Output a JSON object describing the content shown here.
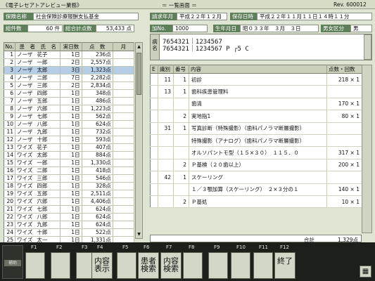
{
  "app": {
    "title": "《電子レセアトアレビュー業務》",
    "screen": "＝ 一覧画面 ＝",
    "rev": "Rev. 600012"
  },
  "header": {
    "insurer_label": "保険名称",
    "insurer_value": "社会保険診療報酬支払基金",
    "total_label": "総件数",
    "total_value": "60 件",
    "points_label": "総合計点数",
    "points_value": "53,433 点",
    "claim_year_label": "請求年月",
    "claim_year_value": "平成２２年１２月",
    "saved_label": "保存日時",
    "saved_value": "平成２２年１１月１１日１４時１１分",
    "add_label": "加No.",
    "add_value": "1000",
    "birth_label": "生年月日",
    "birth_value": "昭０３３年　３月　３日",
    "sex_label": "男女区分",
    "sex_value": "男",
    "disease_label": "病名",
    "disease_line1": "7654321｜1234567",
    "disease_line2": "7654321｜1234567 P ┌5 C"
  },
  "patients": {
    "columns": [
      "No.",
      "患　者　氏　名",
      "実日数",
      "点　数",
      "月"
    ],
    "rows": [
      [
        "1",
        "ノーザ",
        "花子",
        "1日",
        "236点",
        ""
      ],
      [
        "2",
        "ノーザ",
        "一郎",
        "2日",
        "2,557点",
        ""
      ],
      [
        "3",
        "ノーザ",
        "太郎",
        "3日",
        "1,323点",
        ""
      ],
      [
        "4",
        "ノーザ",
        "二郎",
        "7日",
        "2,282点",
        ""
      ],
      [
        "5",
        "ノーザ",
        "三郎",
        "2日",
        "2,834点",
        ""
      ],
      [
        "6",
        "ノーザ",
        "四郎",
        "1日",
        "348点",
        ""
      ],
      [
        "7",
        "ノーザ",
        "五郎",
        "1日",
        "486点",
        ""
      ],
      [
        "8",
        "ノーザ",
        "六郎",
        "1日",
        "1,223点",
        ""
      ],
      [
        "9",
        "ノーザ",
        "七郎",
        "1日",
        "562点",
        ""
      ],
      [
        "10",
        "ノーザ",
        "八郎",
        "1日",
        "624点",
        ""
      ],
      [
        "11",
        "ノーザ",
        "九郎",
        "1日",
        "732点",
        ""
      ],
      [
        "12",
        "ノーザ",
        "十郎",
        "1日",
        "593点",
        ""
      ],
      [
        "13",
        "ワイズ",
        "花子",
        "1日",
        "407点",
        ""
      ],
      [
        "14",
        "ワイズ",
        "太郎",
        "1日",
        "884点",
        ""
      ],
      [
        "15",
        "ワイズ",
        "一郎",
        "1日",
        "1,330点",
        ""
      ],
      [
        "16",
        "ワイズ",
        "二郎",
        "1日",
        "418点",
        ""
      ],
      [
        "17",
        "ワイズ",
        "三郎",
        "1日",
        "546点",
        ""
      ],
      [
        "18",
        "ワイズ",
        "四郎",
        "1日",
        "328点",
        ""
      ],
      [
        "19",
        "ワイズ",
        "五郎",
        "1日",
        "2,511点",
        ""
      ],
      [
        "20",
        "ワイズ",
        "六郎",
        "1日",
        "4,406点",
        ""
      ],
      [
        "21",
        "ワイズ",
        "七郎",
        "1日",
        "624点",
        ""
      ],
      [
        "22",
        "ワイズ",
        "八郎",
        "1日",
        "624点",
        ""
      ],
      [
        "23",
        "ワイズ",
        "九郎",
        "1日",
        "624点",
        ""
      ],
      [
        "24",
        "ワイズ",
        "十郎",
        "1日",
        "522点",
        ""
      ],
      [
        "25",
        "ワイズ",
        "太一",
        "1日",
        "1,331点",
        ""
      ]
    ]
  },
  "details": {
    "columns": [
      "E",
      "識別",
      "番号",
      "内容",
      "点数・回数"
    ],
    "rows": [
      [
        "",
        "11",
        "1",
        "初診",
        "218 × 1"
      ],
      [
        "",
        "13",
        "1",
        "歯科疾患管理料",
        ""
      ],
      [
        "",
        "",
        "",
        "歯清",
        "170 × 1"
      ],
      [
        "",
        "",
        "2",
        "実地指1",
        "80 × 1"
      ],
      [
        "",
        "31",
        "1",
        "写真診断（特殊撮影）（歯科パノラマ断層撮影）",
        ""
      ],
      [
        "",
        "",
        "",
        "特殊撮影（アナログ）（歯科パノラマ断層撮影）",
        ""
      ],
      [
        "",
        "",
        "",
        "オルソパントモ型（１５×３０）　１１５．０",
        "317 × 1"
      ],
      [
        "",
        "",
        "2",
        "Ｐ基検（２０歯以上）",
        "200 × 1"
      ],
      [
        "",
        "42",
        "1",
        "スケーリング",
        ""
      ],
      [
        "",
        "",
        "",
        "１／３顎加算（スケーリング）　２×３分の１",
        "140 × 1"
      ],
      [
        "",
        "",
        "2",
        "Ｐ基処",
        "10 × 1"
      ]
    ],
    "total_label": "合計",
    "total_value": "1,329点"
  },
  "fkeys": {
    "keys": [
      {
        "label": "F1",
        "text": ""
      },
      {
        "label": "F2",
        "text": ""
      },
      {
        "label": "F3",
        "text": ""
      },
      {
        "label": "F4",
        "text": "内容\n表示"
      },
      {
        "label": "F5",
        "text": ""
      },
      {
        "label": "F6",
        "text": "患者\n検索"
      },
      {
        "label": "F7",
        "text": "内容\n検索"
      },
      {
        "label": "F8",
        "text": ""
      },
      {
        "label": "F9",
        "text": ""
      },
      {
        "label": "F10",
        "text": ""
      },
      {
        "label": "F11",
        "text": ""
      },
      {
        "label": "F12",
        "text": "終了"
      }
    ],
    "mini_label": "補助",
    "corner_icon": "keyboard-icon"
  },
  "colors": {
    "label_bg": "#5f7f5a",
    "selected_row": "#b6cde6",
    "fkey_bar": "#1c1f1a"
  }
}
